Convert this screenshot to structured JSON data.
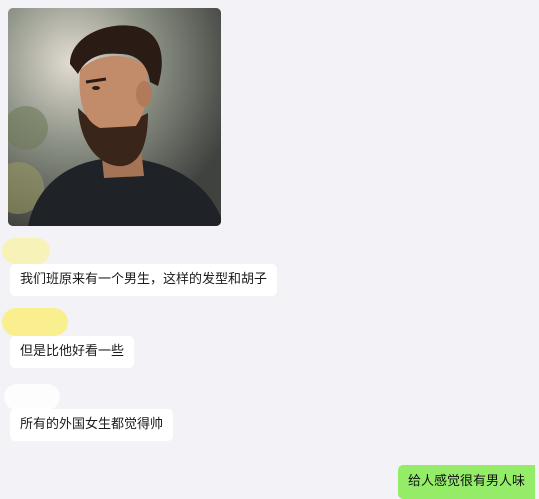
{
  "messages": [
    {
      "text": "我们班原来有一个男生，这样的发型和胡子"
    },
    {
      "text": "但是比他好看一些"
    },
    {
      "text": "所有的外国女生都觉得帅"
    }
  ],
  "reply": {
    "text": "给人感觉很有男人味"
  },
  "colors": {
    "background": "#f3f2f6",
    "incoming_bubble": "#ffffff",
    "outgoing_bubble": "#95ec69"
  }
}
